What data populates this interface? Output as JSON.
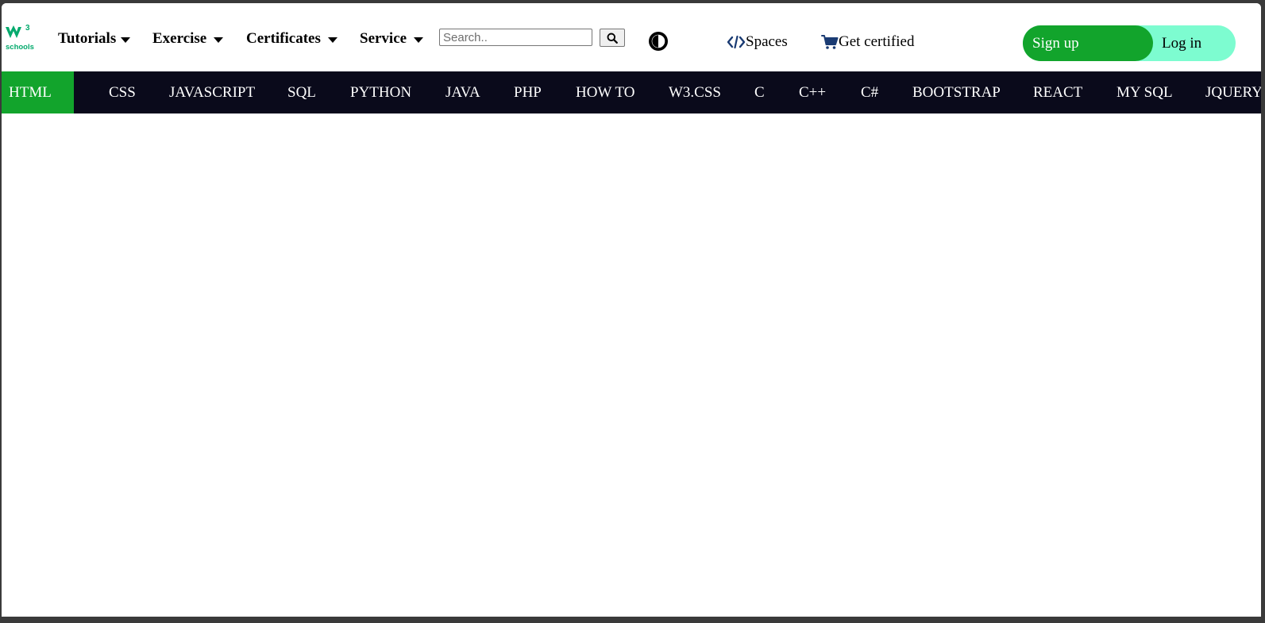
{
  "header": {
    "logo": {
      "text": "schools",
      "superscript": "3",
      "color": "#04aa6d"
    },
    "menus": [
      {
        "label": "Tutorials"
      },
      {
        "label": "Exercise"
      },
      {
        "label": "Certificates"
      },
      {
        "label": "Service"
      }
    ],
    "search": {
      "placeholder": "Search..",
      "value": ""
    },
    "theme_toggle_icon": "contrast-icon",
    "spaces_label": "Spaces",
    "spaces_icon": "code-icon",
    "certified_label": "Get certified",
    "certified_icon": "cart-icon",
    "signup_label": "Sign up",
    "login_label": "Log in"
  },
  "topics": [
    {
      "label": "HTML",
      "active": true
    },
    {
      "label": "CSS"
    },
    {
      "label": "JAVASCRIPT"
    },
    {
      "label": "SQL"
    },
    {
      "label": "PYTHON"
    },
    {
      "label": "JAVA"
    },
    {
      "label": "PHP"
    },
    {
      "label": "HOW TO"
    },
    {
      "label": "W3.CSS"
    },
    {
      "label": "C"
    },
    {
      "label": "C++"
    },
    {
      "label": "C#"
    },
    {
      "label": "BOOTSTRAP"
    },
    {
      "label": "REACT"
    },
    {
      "label": "MY SQL"
    },
    {
      "label": "JQUERY"
    }
  ],
  "colors": {
    "brand_green": "#04aa6d",
    "signup_green": "#12a42c",
    "login_mint": "#7dfcd0",
    "topnav_dark": "#0a0a1b"
  }
}
